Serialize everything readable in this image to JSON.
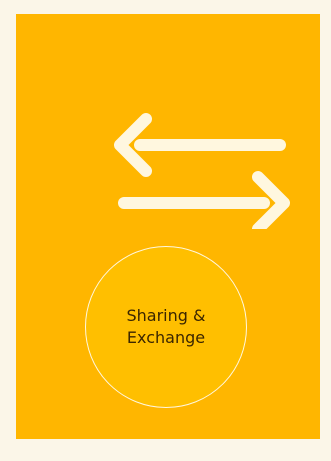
{
  "card": {
    "label": "Sharing & Exchange",
    "icon": "swap-horizontal-arrows-icon",
    "colors": {
      "page_background": "#fbf6e8",
      "card_background": "#ffb600",
      "circle_background": "#ffbf00",
      "icon_color": "#fff7df",
      "text_color": "#3b2600"
    }
  }
}
